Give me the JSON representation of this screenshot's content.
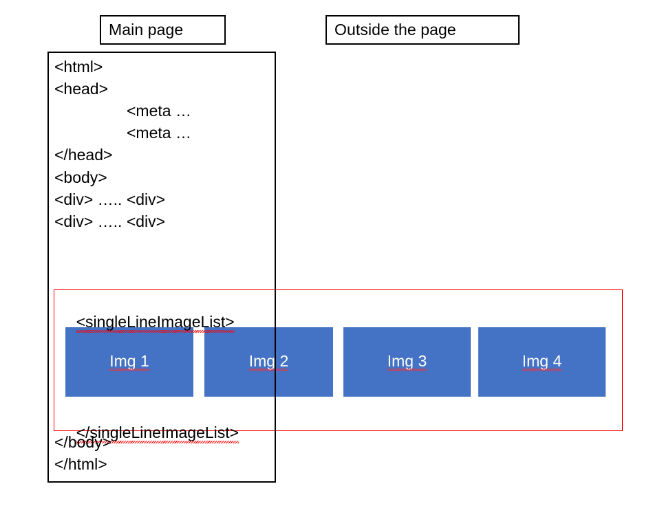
{
  "captions": {
    "main_page": "Main page",
    "outside_page": "Outside the page"
  },
  "code": {
    "lines": [
      {
        "text": "<html>",
        "indented": false
      },
      {
        "text": "<head>",
        "indented": false
      },
      {
        "text": "<meta …",
        "indented": true
      },
      {
        "text": "<meta …",
        "indented": true
      },
      {
        "text": "</head>",
        "indented": false
      },
      {
        "text": "<body>",
        "indented": false
      },
      {
        "text": "<div> ….. <div>",
        "indented": false
      },
      {
        "text": "<div> ….. <div>",
        "indented": false
      }
    ],
    "list_open_tag": "<singleLineImageList>",
    "list_close_tag": "</singleLineImageList>",
    "body_close_tag": "</body>",
    "html_close_tag": "</html>"
  },
  "image_list": {
    "items": [
      {
        "label": "Img 1"
      },
      {
        "label": "Img 2"
      },
      {
        "label": "Img 3"
      },
      {
        "label": "Img 4"
      }
    ]
  },
  "colors": {
    "image_fill": "#4472C4",
    "highlight_border": "#FF0000",
    "frame_border": "#000000",
    "spellcheck_underline": "#FF0000"
  }
}
